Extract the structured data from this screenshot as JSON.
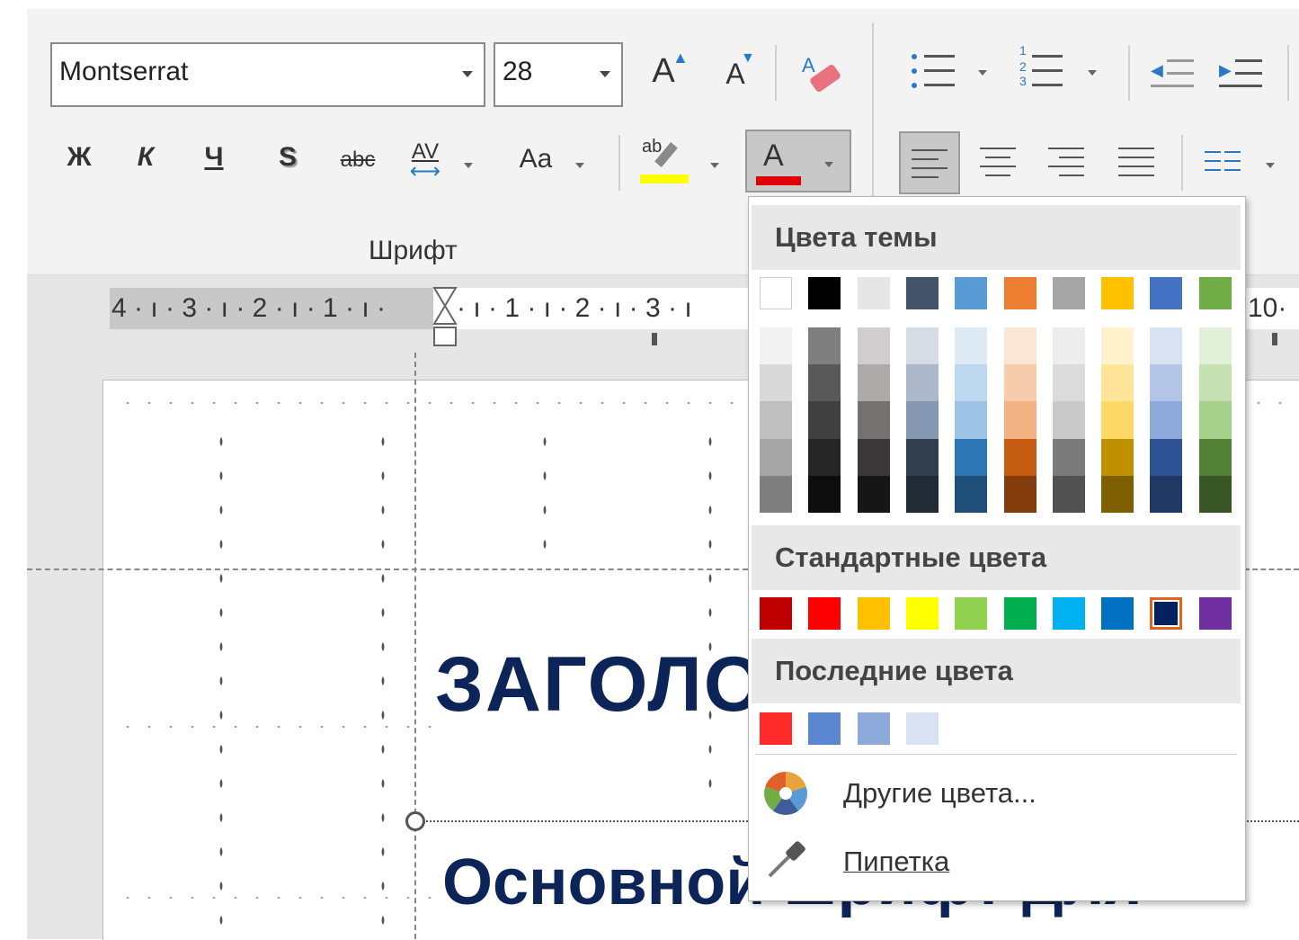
{
  "ribbon": {
    "font_name": "Montserrat",
    "font_size": "28",
    "group_label": "Шрифт",
    "bold": "Ж",
    "italic": "К",
    "underline": "Ч",
    "shadow": "S",
    "strike": "abc",
    "spacing": "AV",
    "case": "Aa",
    "grow": "A",
    "shrink": "A",
    "highlight_letters": "ab",
    "font_color_letter": "A",
    "highlight_color": "#ffff00",
    "font_color": "#e00000"
  },
  "ruler": {
    "labels_left": "4 · ı · 3 · ı · 2 · ı · 1 · ı ·",
    "labels_right": "· ı · 1 · ı · 2 · ı · 3 · ı",
    "label_10": "10·"
  },
  "slide": {
    "heading": "ЗАГОЛОВОК",
    "body": "Основной шрифт для"
  },
  "menu": {
    "theme_header": "Цвета темы",
    "standard_header": "Стандартные цвета",
    "recent_header": "Последние цвета",
    "more_colors": "Другие цвета...",
    "eyedropper": "Пипетка",
    "theme_colors": [
      "#ffffff",
      "#000000",
      "#e7e6e6",
      "#44546a",
      "#5b9bd5",
      "#ed7d31",
      "#a5a5a5",
      "#ffc000",
      "#4472c4",
      "#70ad47"
    ],
    "theme_shades": [
      [
        "#f2f2f2",
        "#d9d9d9",
        "#bfbfbf",
        "#a6a6a6",
        "#7f7f7f"
      ],
      [
        "#7f7f7f",
        "#595959",
        "#404040",
        "#262626",
        "#0d0d0d"
      ],
      [
        "#d0cece",
        "#aeaaaa",
        "#757171",
        "#3a3838",
        "#171616"
      ],
      [
        "#d6dce4",
        "#adb9ca",
        "#8496b0",
        "#323f4f",
        "#222a35"
      ],
      [
        "#deebf6",
        "#bdd7ee",
        "#9dc3e6",
        "#2e75b5",
        "#1f4e79"
      ],
      [
        "#fbe5d5",
        "#f7cbac",
        "#f4b183",
        "#c55a11",
        "#843c0c"
      ],
      [
        "#ededed",
        "#dbdbdb",
        "#c9c9c9",
        "#7b7b7b",
        "#525252"
      ],
      [
        "#fff2cc",
        "#fee599",
        "#ffd965",
        "#bf9000",
        "#7f6000"
      ],
      [
        "#d9e2f3",
        "#b4c6e7",
        "#8eaadb",
        "#2f5496",
        "#1f3864"
      ],
      [
        "#e2efd9",
        "#c5e0b3",
        "#a8d08d",
        "#538135",
        "#375623"
      ]
    ],
    "standard_colors": [
      "#c00000",
      "#ff0000",
      "#ffc000",
      "#ffff00",
      "#92d050",
      "#00b050",
      "#00b0f0",
      "#0070c0",
      "#002060",
      "#7030a0"
    ],
    "selected_standard_index": 8,
    "recent_colors": [
      "#ff2b2b",
      "#5b86d0",
      "#8eaadb",
      "#d9e2f3"
    ]
  }
}
